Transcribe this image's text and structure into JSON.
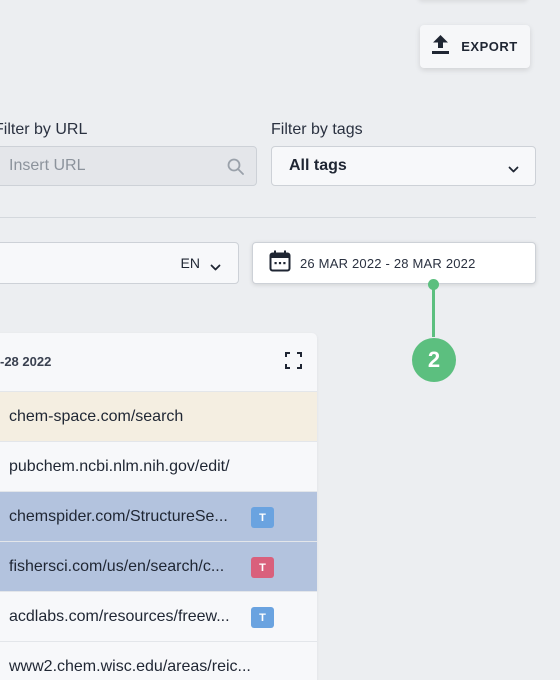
{
  "toolbar": {
    "export_label": "EXPORT",
    "export_icon": "upload-icon"
  },
  "filters": {
    "url_label": "Filter by URL",
    "url_placeholder": "Insert URL",
    "tags_label": "Filter by tags",
    "tags_value": "All tags"
  },
  "language": {
    "value": "EN"
  },
  "date_range": {
    "value": "26 MAR 2022 - 28 MAR 2022",
    "icon": "calendar-icon"
  },
  "step_marker": {
    "number": "2",
    "color": "#5cbf7f"
  },
  "panel": {
    "header_text": "-28 2022",
    "rows": [
      {
        "url": "chem-space.com/search",
        "bg": "#f4eee1",
        "tag": null
      },
      {
        "url": "pubchem.ncbi.nlm.nih.gov/edit/",
        "bg": "#f7f8fa",
        "tag": null
      },
      {
        "url": "chemspider.com/StructureSe...",
        "bg": "#b3c3de",
        "tag": {
          "label": "T",
          "color": "#6aa3e0"
        }
      },
      {
        "url": "fishersci.com/us/en/search/c...",
        "bg": "#b3c3de",
        "tag": {
          "label": "T",
          "color": "#d9607c"
        }
      },
      {
        "url": "acdlabs.com/resources/freew...",
        "bg": "#f7f8fa",
        "tag": {
          "label": "T",
          "color": "#6aa3e0"
        }
      },
      {
        "url": "www2.chem.wisc.edu/areas/reic...",
        "bg": "#f7f8fa",
        "tag": null
      }
    ]
  }
}
